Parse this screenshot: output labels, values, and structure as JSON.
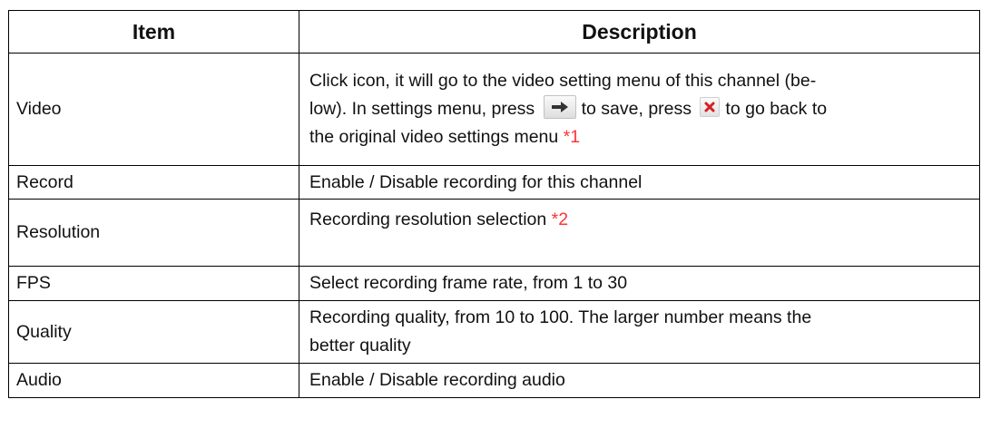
{
  "table": {
    "headers": [
      "Item",
      "Description"
    ],
    "rows": [
      {
        "item": "Video",
        "lines": [
          "Click icon, it will go to the video setting menu of this channel (be-",
          "low). In settings menu, press",
          "to save, press",
          "to go back to",
          "the original video settings menu",
          "*1"
        ],
        "icons": [
          "arrow-right-icon",
          "close-x-icon"
        ]
      },
      {
        "item": "Record",
        "description": "Enable / Disable recording for this channel"
      },
      {
        "item": "Resolution",
        "description": "Recording resolution selection",
        "note": "*2"
      },
      {
        "item": "FPS",
        "description": "Select recording frame rate, from 1 to 30"
      },
      {
        "item": "Quality",
        "lines": [
          "Recording quality, from 10 to 100. The larger number means the",
          "better quality"
        ]
      },
      {
        "item": "Audio",
        "description": "Enable / Disable recording audio"
      }
    ]
  },
  "colors": {
    "note": "#ff3333",
    "arrow": "#333333",
    "close": "#d62020"
  }
}
